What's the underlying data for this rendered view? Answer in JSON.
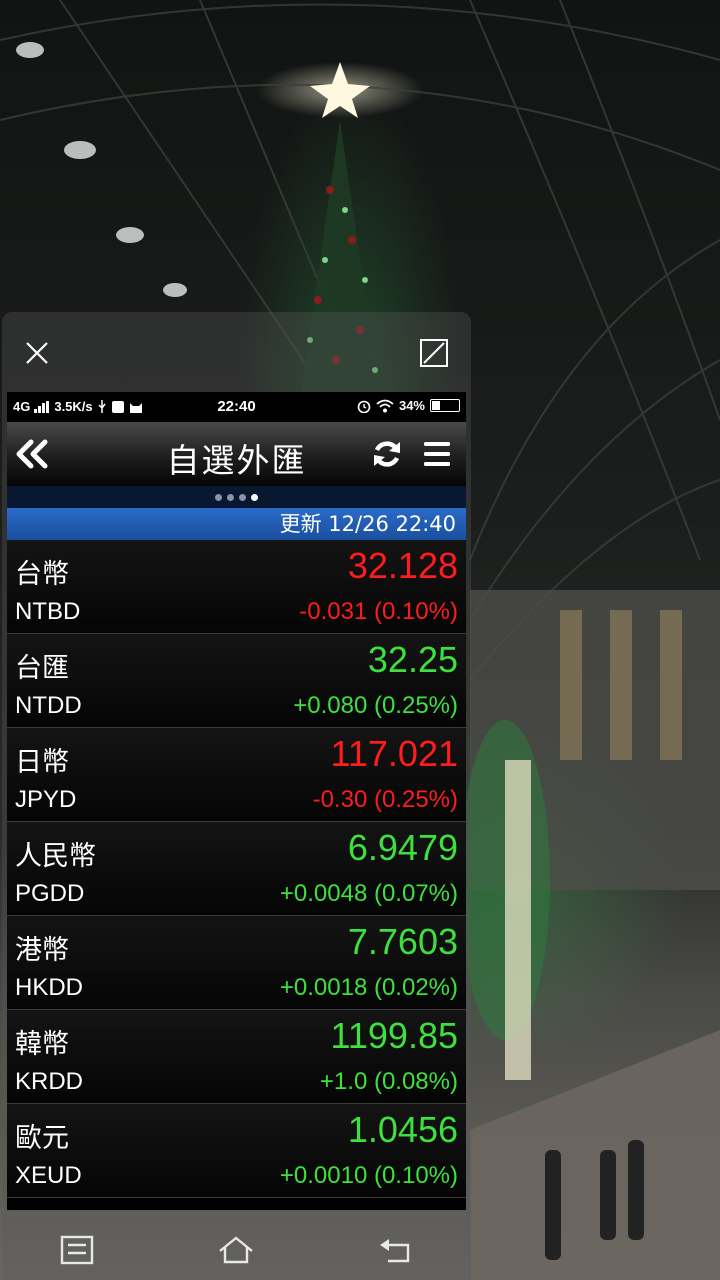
{
  "status_bar": {
    "network": "4G",
    "speed": "3.5K/s",
    "time": "22:40",
    "battery": "34%",
    "battery_level": 0.34
  },
  "app": {
    "title": "自選外匯",
    "page_count": 4,
    "active_page": 4,
    "update_label": "更新",
    "update_time": "12/26 22:40"
  },
  "colors": {
    "up": "#3ee03e",
    "down": "#ff1c1c",
    "header_blue": "#1a4f9e"
  },
  "icons": {
    "back": "double-chevron-left-icon",
    "refresh": "refresh-icon",
    "menu": "hamburger-menu-icon",
    "close": "close-icon",
    "resize": "resize-icon"
  },
  "rates": [
    {
      "name": "台幣",
      "code": "NTBD",
      "price": "32.128",
      "change": "-0.031 (0.10%)",
      "dir": "down"
    },
    {
      "name": "台匯",
      "code": "NTDD",
      "price": "32.25",
      "change": "+0.080 (0.25%)",
      "dir": "up"
    },
    {
      "name": "日幣",
      "code": "JPYD",
      "price": "117.021",
      "change": "-0.30 (0.25%)",
      "dir": "down"
    },
    {
      "name": "人民幣",
      "code": "PGDD",
      "price": "6.9479",
      "change": "+0.0048 (0.07%)",
      "dir": "up"
    },
    {
      "name": "港幣",
      "code": "HKDD",
      "price": "7.7603",
      "change": "+0.0018 (0.02%)",
      "dir": "up"
    },
    {
      "name": "韓幣",
      "code": "KRDD",
      "price": "1199.85",
      "change": "+1.0 (0.08%)",
      "dir": "up"
    },
    {
      "name": "歐元",
      "code": "XEUD",
      "price": "1.0456",
      "change": "+0.0010 (0.10%)",
      "dir": "up"
    }
  ]
}
